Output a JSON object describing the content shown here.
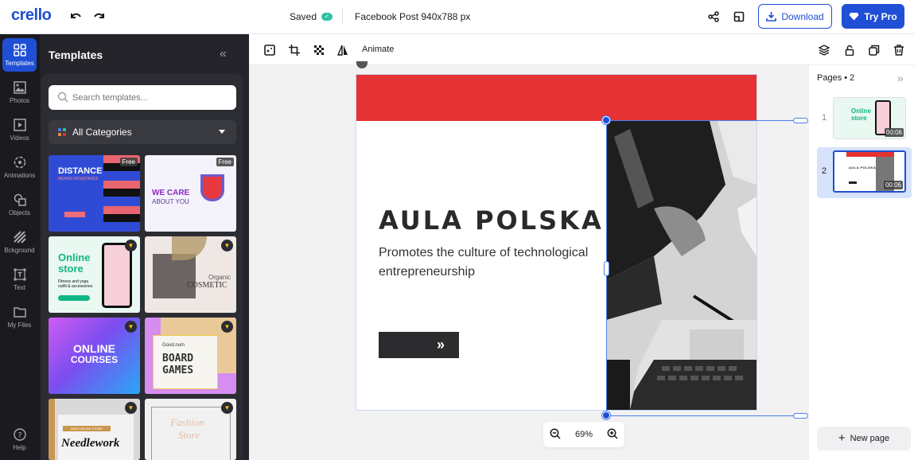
{
  "app": {
    "logo": "crello",
    "brand_color": "#1f4fd4"
  },
  "topbar": {
    "undo_icon": "undo-icon",
    "redo_icon": "redo-icon",
    "saved_label": "Saved",
    "doc_title": "Facebook Post 940x788 px",
    "share_icon": "share-icon",
    "resize_icon": "resize-icon",
    "download_label": "Download",
    "trypro_label": "Try Pro"
  },
  "rail": {
    "items": [
      {
        "label": "Templates",
        "icon": "templates-icon",
        "active": true
      },
      {
        "label": "Photos",
        "icon": "photos-icon"
      },
      {
        "label": "Videos",
        "icon": "videos-icon"
      },
      {
        "label": "Animations",
        "icon": "animations-icon"
      },
      {
        "label": "Objects",
        "icon": "objects-icon"
      },
      {
        "label": "Bckground",
        "icon": "background-icon"
      },
      {
        "label": "Text",
        "icon": "text-icon"
      },
      {
        "label": "My Files",
        "icon": "folder-icon"
      }
    ],
    "help_label": "Help"
  },
  "panel": {
    "title": "Templates",
    "search_placeholder": "Search templates...",
    "category": "All Categories",
    "templates": [
      {
        "title": "DISTANCE",
        "subtitle": "MEANS RESISTANCE",
        "badge": "Free",
        "bg": "#2f4bd6"
      },
      {
        "title": "WE CARE",
        "subtitle": "ABOUT YOU",
        "badge": "Free",
        "bg": "#f4f2fb"
      },
      {
        "title": "Online",
        "subtitle": "store",
        "extra": "Fitness and yoga outfit & accessories",
        "badge": "pro",
        "bg": "#e9f8f1"
      },
      {
        "title": "Organic",
        "subtitle": "COSMETIC",
        "badge": "pro",
        "bg": "#efe7e4"
      },
      {
        "title": "ONLINE",
        "subtitle": "COURSES",
        "badge": "pro",
        "bg": "#7b4df0"
      },
      {
        "title": "BOARD",
        "subtitle": "GAMES",
        "extra": "Good.num",
        "badge": "pro",
        "bg": "#d58ef0"
      },
      {
        "title": "Needlework",
        "subtitle": "NEW ONLINE STORE",
        "badge": "pro",
        "bg": "#d9d9d9"
      },
      {
        "title": "Fashion",
        "subtitle": "Store",
        "badge": "pro",
        "bg": "#f1f1f1"
      }
    ]
  },
  "toolbar": {
    "left_icons": [
      "adjust-icon",
      "crop-icon",
      "transparency-icon",
      "flip-icon"
    ],
    "animate_label": "Animate",
    "right_icons": [
      "layers-icon",
      "lock-icon",
      "duplicate-icon",
      "trash-icon"
    ]
  },
  "design": {
    "headline": "AULA POLSKA",
    "subtitle": "Promotes the culture of technological entrepreneurship",
    "cta_icon": "»",
    "accent": "#e53233"
  },
  "zoom": {
    "value": "69%"
  },
  "pages": {
    "title": "Pages",
    "count": "• 2",
    "items": [
      {
        "num": "1",
        "duration": "00:06",
        "thumb_title": "Online store",
        "active": false
      },
      {
        "num": "2",
        "duration": "00:06",
        "thumb_title": "AULA POLSKA",
        "active": true
      }
    ],
    "new_page_label": "New page"
  }
}
